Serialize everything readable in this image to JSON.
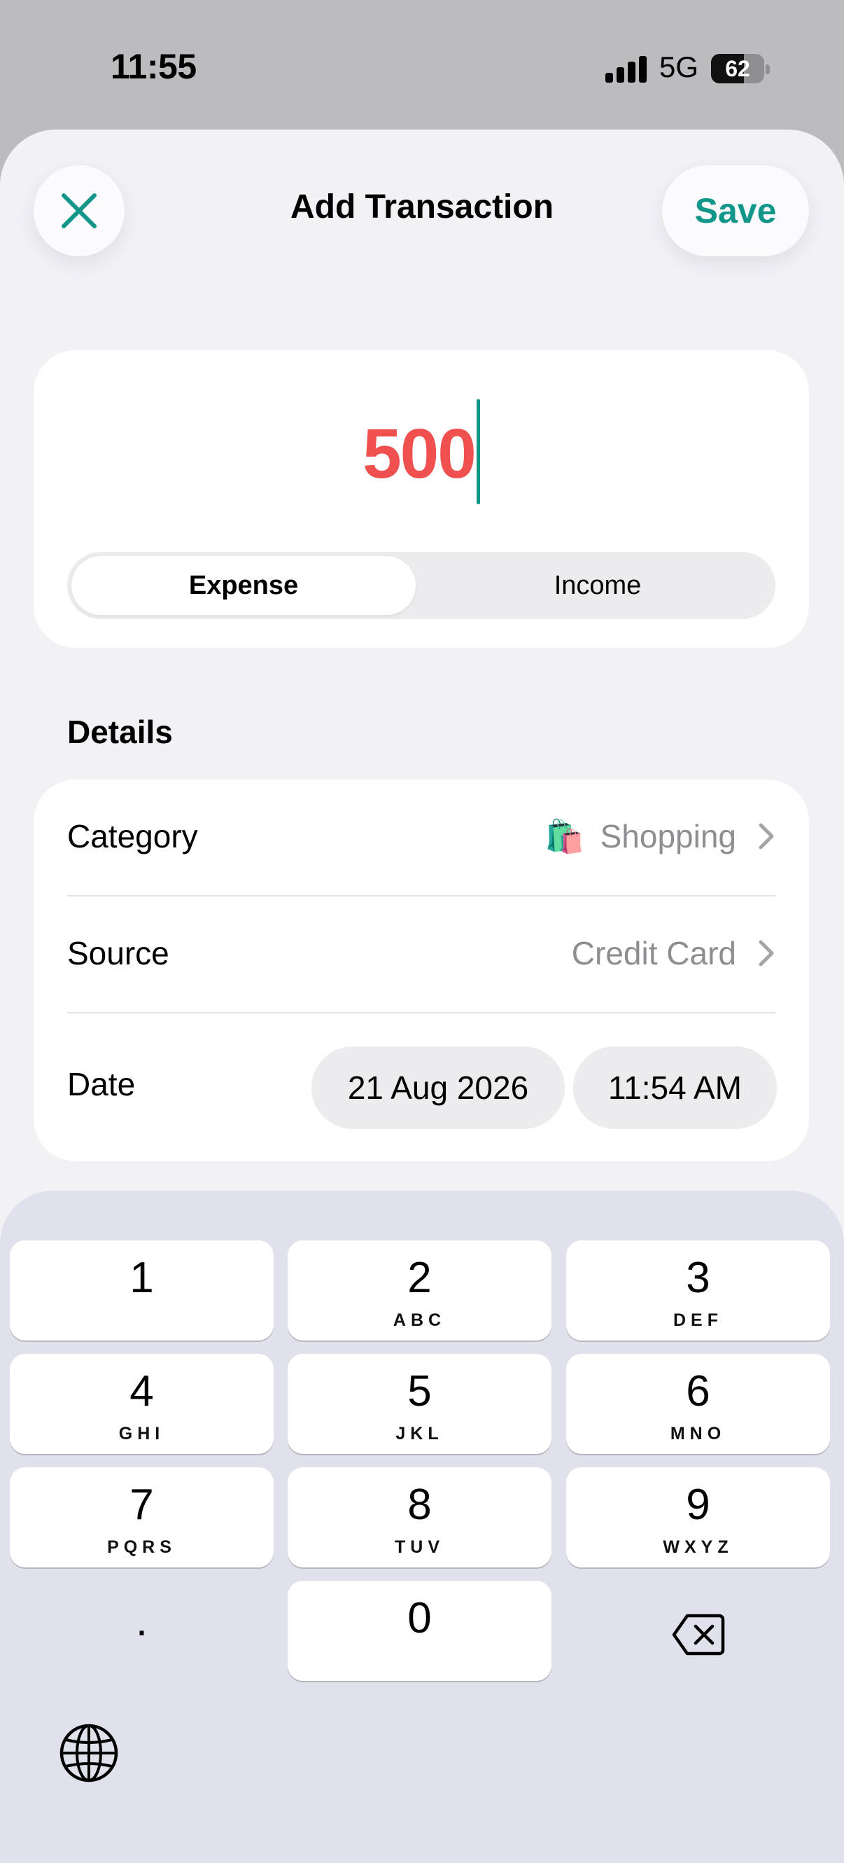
{
  "status_bar": {
    "time": "11:55",
    "network": "5G",
    "battery": "62",
    "battery_level": 0.62
  },
  "header": {
    "title": "Add Transaction",
    "save_label": "Save",
    "close_icon": "close-icon"
  },
  "amount": {
    "value": "500",
    "color": "#f0504e",
    "types": [
      {
        "label": "Expense",
        "selected": true
      },
      {
        "label": "Income",
        "selected": false
      }
    ]
  },
  "details": {
    "section_title": "Details",
    "category": {
      "label": "Category",
      "emoji": "🛍️",
      "value": "Shopping"
    },
    "source": {
      "label": "Source",
      "value": "Credit Card"
    },
    "date": {
      "label": "Date",
      "date": "21 Aug 2026",
      "time": "11:54 AM"
    }
  },
  "keypad": {
    "keys": [
      {
        "digit": "1",
        "letters": ""
      },
      {
        "digit": "2",
        "letters": "ABC"
      },
      {
        "digit": "3",
        "letters": "DEF"
      },
      {
        "digit": "4",
        "letters": "GHI"
      },
      {
        "digit": "5",
        "letters": "JKL"
      },
      {
        "digit": "6",
        "letters": "MNO"
      },
      {
        "digit": "7",
        "letters": "PQRS"
      },
      {
        "digit": "8",
        "letters": "TUV"
      },
      {
        "digit": "9",
        "letters": "WXYZ"
      },
      {
        "digit": ".",
        "letters": ""
      },
      {
        "digit": "0",
        "letters": ""
      }
    ],
    "delete_icon": "backspace-icon",
    "globe_icon": "globe-icon"
  },
  "colors": {
    "accent": "#12968a",
    "expense": "#f0504e",
    "sheet_bg": "#f1f1f6",
    "keyboard_bg": "#dfe1eb"
  }
}
